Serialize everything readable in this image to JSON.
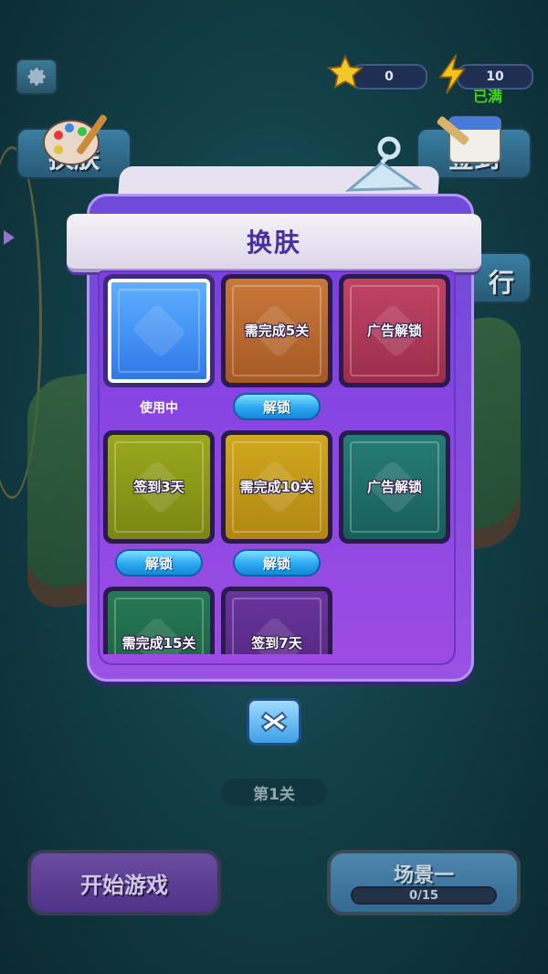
{
  "top_bar": {
    "stars": "0",
    "energy": "10",
    "energy_status": "已满"
  },
  "side_buttons": {
    "skin": "换肤",
    "sign_in": "签到",
    "rank": "行"
  },
  "modal": {
    "title": "换肤",
    "cards": [
      {
        "label": "",
        "color": "#3d8ff2",
        "status": "使用中",
        "selected": true
      },
      {
        "label": "需完成5关",
        "color": "#b8682e",
        "action": "解锁"
      },
      {
        "label": "广告解锁",
        "color": "#b03a5a"
      },
      {
        "label": "签到3天",
        "color": "#8e9a17",
        "action": "解锁"
      },
      {
        "label": "需完成10关",
        "color": "#c29a16",
        "action": "解锁"
      },
      {
        "label": "广告解锁",
        "color": "#1f6f6a"
      },
      {
        "label": "需完成15关",
        "color": "#1d6a4a"
      },
      {
        "label": "签到7天",
        "color": "#5a2a8a"
      }
    ]
  },
  "level_label": "第1关",
  "start_button": "开始游戏",
  "scene": {
    "title": "场景一",
    "progress_text": "0/15",
    "progress": 0.0
  },
  "colors": {
    "modal_purple": "#8a4ae0",
    "unlock_blue": "#2aa7ef",
    "full_green": "#49d41f"
  }
}
